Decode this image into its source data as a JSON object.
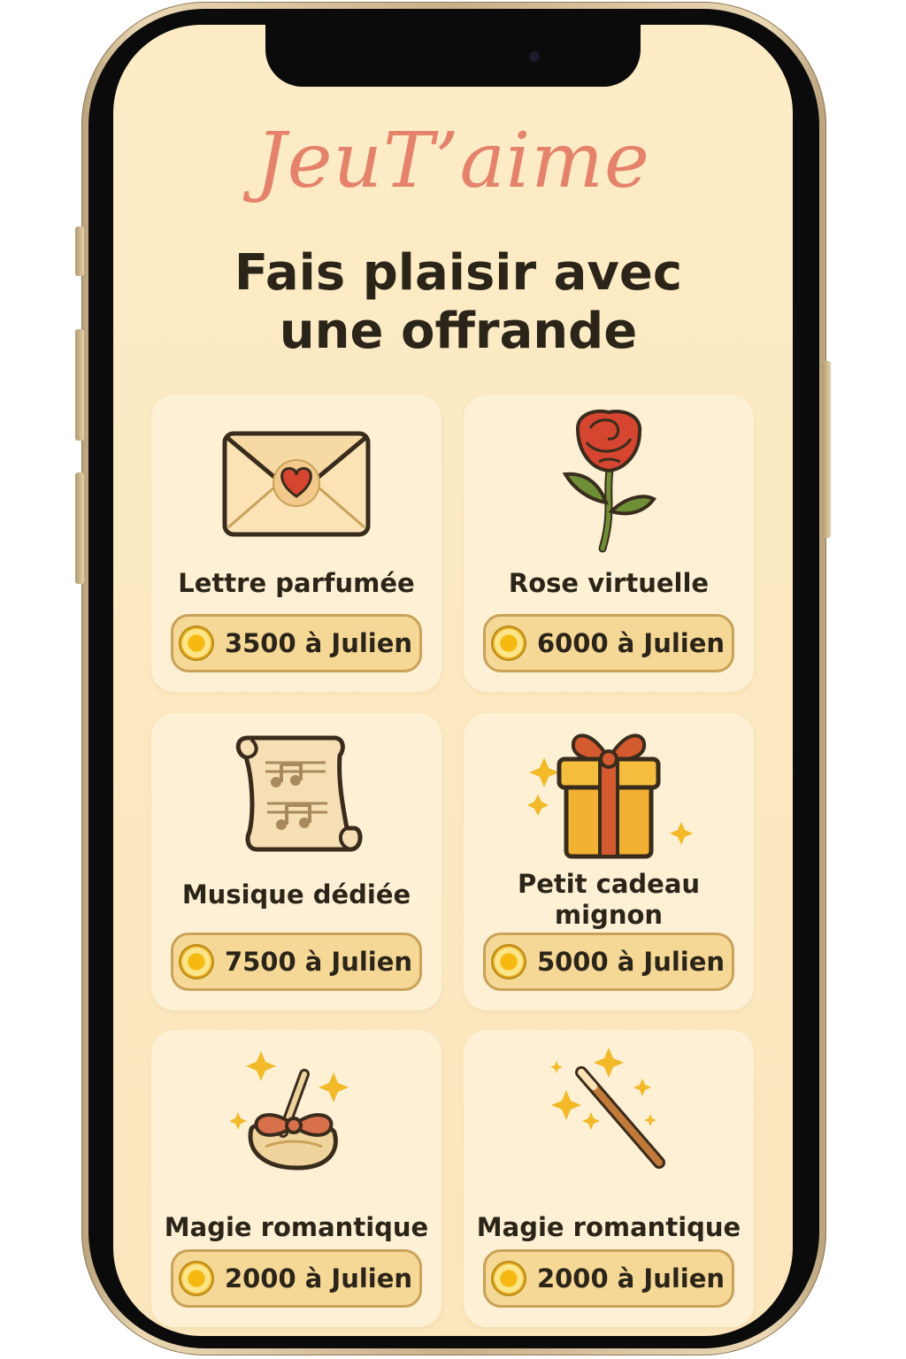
{
  "app": {
    "title": "JeuT’aime",
    "headline": "Fais plaisir avec\nune offrande"
  },
  "colors": {
    "accent": "#e5826b",
    "background": "#fdecc6",
    "card": "#fdf0d4",
    "price_pill": "#f6d896",
    "coin": "#f5b912"
  },
  "offerings": [
    {
      "label": "Lettre parfumée",
      "price": "3500 à Julien",
      "icon": "love-letter-icon"
    },
    {
      "label": "Rose virtuelle",
      "price": "6000 à Julien",
      "icon": "rose-icon"
    },
    {
      "label": "Musique dédiée",
      "price": "7500 à Julien",
      "icon": "music-scroll-icon"
    },
    {
      "label": "Petit cadeau\nmignon",
      "price": "5000 à Julien",
      "icon": "gift-box-icon"
    },
    {
      "label": "Magie romantique",
      "price": "2000 à Julien",
      "icon": "enchanted-pouch-icon"
    },
    {
      "label": "Magie romantique",
      "price": "2000 à Julien",
      "icon": "magic-wand-icon"
    }
  ]
}
